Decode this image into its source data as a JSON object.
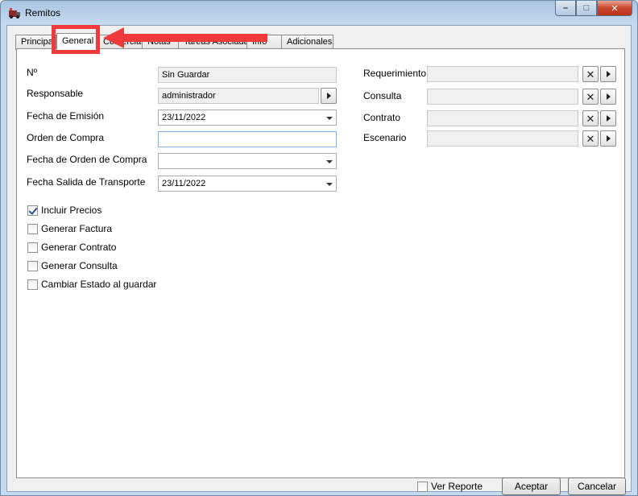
{
  "window": {
    "title": "Remitos"
  },
  "tabs": [
    {
      "label": "Principal"
    },
    {
      "label": "General"
    },
    {
      "label": "Comercial"
    },
    {
      "label": "Notas"
    },
    {
      "label": "Tareas Asociadas"
    },
    {
      "label": "Info"
    },
    {
      "label": "Adicionales"
    }
  ],
  "form_left": {
    "numero": {
      "label": "Nº",
      "value": "Sin Guardar"
    },
    "responsable": {
      "label": "Responsable",
      "value": "administrador"
    },
    "fecha_emision": {
      "label": "Fecha de Emisión",
      "value": "23/11/2022"
    },
    "orden_compra": {
      "label": "Orden de Compra",
      "value": ""
    },
    "fecha_orden_compra": {
      "label": "Fecha de Orden de Compra",
      "value": ""
    },
    "fecha_salida": {
      "label": "Fecha Salida de Transporte",
      "value": "23/11/2022"
    }
  },
  "form_right": {
    "requerimiento": {
      "label": "Requerimiento",
      "value": ""
    },
    "consulta": {
      "label": "Consulta",
      "value": ""
    },
    "contrato": {
      "label": "Contrato",
      "value": ""
    },
    "escenario": {
      "label": "Escenario",
      "value": ""
    }
  },
  "checkboxes": [
    {
      "label": "Incluir Precios",
      "checked": true
    },
    {
      "label": "Generar Factura",
      "checked": false
    },
    {
      "label": "Generar Contrato",
      "checked": false
    },
    {
      "label": "Generar Consulta",
      "checked": false
    },
    {
      "label": "Cambiar Estado al guardar",
      "checked": false
    }
  ],
  "footer": {
    "ver_reporte": "Ver Reporte",
    "aceptar": "Aceptar",
    "cancelar": "Cancelar"
  },
  "glyphs": {
    "clear": "✕",
    "minimize": "–",
    "maximize": "□",
    "close": "✕"
  },
  "colors": {
    "annotation": "#ef3b3b",
    "accent_focus": "#7eb4ea"
  }
}
